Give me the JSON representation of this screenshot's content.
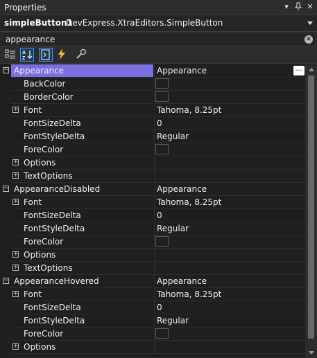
{
  "window": {
    "title": "Properties",
    "pin_glyph": "⊓",
    "dropdown_glyph": "▾",
    "close_glyph": "✕"
  },
  "object_selector": {
    "name": "simpleButton1",
    "type": "DevExpress.XtraEditors.SimpleButton"
  },
  "search": {
    "value": "appearance"
  },
  "toolbar": {
    "buttons": [
      {
        "icon": "categorized-icon",
        "active": false
      },
      {
        "icon": "alphabetical-icon",
        "active": true
      },
      {
        "icon": "properties-icon",
        "active": true
      },
      {
        "icon": "events-icon",
        "active": false
      },
      {
        "icon": "property-pages-icon",
        "active": false
      }
    ]
  },
  "grid": {
    "rows": [
      {
        "name": "Appearance",
        "value": "Appearance",
        "kind": "category",
        "selected": true,
        "ellipsis": true
      },
      {
        "name": "BackColor",
        "value": "",
        "kind": "color"
      },
      {
        "name": "BorderColor",
        "value": "",
        "kind": "color"
      },
      {
        "name": "Font",
        "value": "Tahoma, 8.25pt",
        "kind": "expandable"
      },
      {
        "name": "FontSizeDelta",
        "value": "0",
        "kind": "plain"
      },
      {
        "name": "FontStyleDelta",
        "value": "Regular",
        "kind": "plain"
      },
      {
        "name": "ForeColor",
        "value": "",
        "kind": "color"
      },
      {
        "name": "Options",
        "value": "",
        "kind": "expandable"
      },
      {
        "name": "TextOptions",
        "value": "",
        "kind": "expandable"
      },
      {
        "name": "AppearanceDisabled",
        "value": "Appearance",
        "kind": "category"
      },
      {
        "name": "Font",
        "value": "Tahoma, 8.25pt",
        "kind": "expandable"
      },
      {
        "name": "FontSizeDelta",
        "value": "0",
        "kind": "plain"
      },
      {
        "name": "FontStyleDelta",
        "value": "Regular",
        "kind": "plain"
      },
      {
        "name": "ForeColor",
        "value": "",
        "kind": "color"
      },
      {
        "name": "Options",
        "value": "",
        "kind": "expandable"
      },
      {
        "name": "TextOptions",
        "value": "",
        "kind": "expandable"
      },
      {
        "name": "AppearanceHovered",
        "value": "Appearance",
        "kind": "category"
      },
      {
        "name": "Font",
        "value": "Tahoma, 8.25pt",
        "kind": "expandable"
      },
      {
        "name": "FontSizeDelta",
        "value": "0",
        "kind": "plain"
      },
      {
        "name": "FontStyleDelta",
        "value": "Regular",
        "kind": "plain"
      },
      {
        "name": "ForeColor",
        "value": "",
        "kind": "color"
      },
      {
        "name": "Options",
        "value": "",
        "kind": "expandable"
      }
    ]
  },
  "colors": {
    "selection": "#7a6fe0",
    "background": "#1f1f1f",
    "toolbar_active": "#3399ff"
  }
}
